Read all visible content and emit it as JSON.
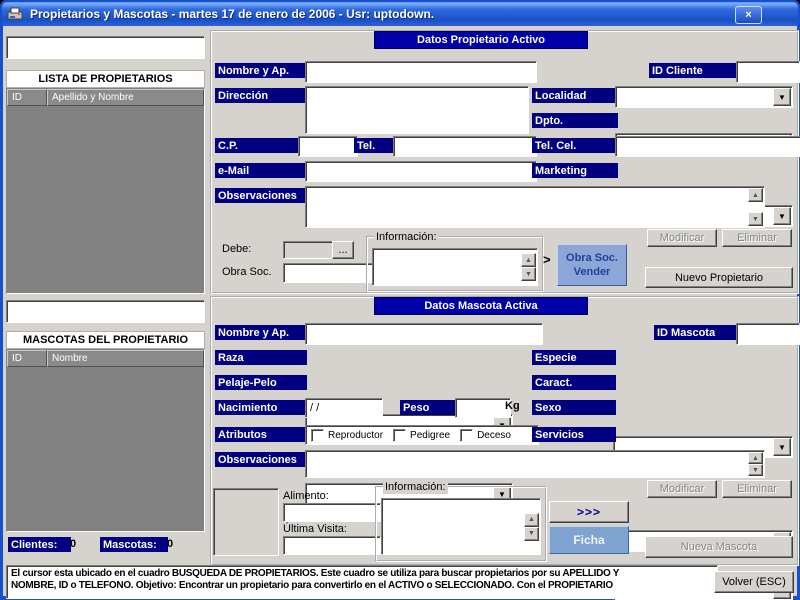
{
  "titlebar": {
    "title": "Propietarios y Mascotas - martes 17 de enero de 2006 - Usr: uptodown.",
    "close_glyph": "×"
  },
  "icons": {
    "dropdown_arrow": "▼",
    "scroll_up": "▲",
    "scroll_down": "▼",
    "chevron_right": ">",
    "chevrons_right": ">>>"
  },
  "sidebar": {
    "owner_search_value": "",
    "owners_title": "LISTA DE PROPIETARIOS",
    "owners_columns": {
      "id": "ID",
      "name": "Apellido y Nombre"
    },
    "pet_search_value": "",
    "pets_title": "MASCOTAS DEL PROPIETARIO",
    "pets_columns": {
      "id": "ID",
      "name": "Nombre"
    },
    "clients_label": "Clientes:",
    "clients_count": "0",
    "pets_label": "Mascotas:",
    "pets_count": "0"
  },
  "owner": {
    "section_title": "Datos Propietario Activo",
    "labels": {
      "nombre": "Nombre y Ap.",
      "id_cliente": "ID Cliente",
      "direccion": "Dirección",
      "localidad": "Localidad",
      "dpto": "Dpto.",
      "cp": "C.P.",
      "tel": "Tel.",
      "tel_cel": "Tel. Cel.",
      "email": "e-Mail",
      "marketing": "Marketing",
      "observaciones": "Observaciones",
      "debe": "Debe:",
      "obra_soc": "Obra Soc.",
      "informacion": "Información:"
    },
    "values": {
      "nombre": "",
      "id_cliente": "",
      "direccion": "",
      "cp": "",
      "tel": "",
      "tel_cel": "",
      "email": "",
      "observaciones": "",
      "debe": "",
      "obra_soc": "",
      "informacion": ""
    },
    "buttons": {
      "modificar": "Modificar",
      "eliminar": "Eliminar",
      "dots": "...",
      "obra_soc_line1": "Obra Soc.",
      "obra_soc_line2": "Vender",
      "nuevo_propietario": "Nuevo Propietario"
    }
  },
  "pet": {
    "section_title": "Datos Mascota Activa",
    "labels": {
      "nombre": "Nombre y Ap.",
      "id_mascota": "ID Mascota",
      "raza": "Raza",
      "especie": "Especie",
      "pelaje": "Pelaje-Pelo",
      "caract": "Caract.",
      "nacimiento": "Nacimiento",
      "peso": "Peso",
      "kg": "Kg",
      "sexo": "Sexo",
      "atributos": "Atributos",
      "servicios": "Servicios",
      "observaciones": "Observaciones",
      "alimento": "Alimento:",
      "ultima_visita": "Última Visita:",
      "informacion": "Información:"
    },
    "values": {
      "nombre": "",
      "id_mascota": "",
      "nacimiento": "/ /",
      "peso": "",
      "observaciones": "",
      "alimento": "",
      "ultima_visita": "",
      "informacion": ""
    },
    "checkboxes": [
      "Reproductor",
      "Pedigree",
      "Deceso"
    ],
    "buttons": {
      "modificar": "Modificar",
      "eliminar": "Eliminar",
      "ficha": "Ficha",
      "nueva_mascota": "Nueva Mascota"
    }
  },
  "statusbar": {
    "line1": "El cursor esta ubicado en el cuadro BUSQUEDA DE PROPIETARIOS. Este cuadro se utiliza para buscar propietarios por su APELLIDO Y",
    "line2": "NOMBRE, ID o TELEFONO. Objetivo: Encontrar un propietario para convertirlo en el ACTIVO o SELECCIONADO. Con el PROPIETARIO",
    "volver": "Volver (ESC)"
  },
  "colors": {
    "label_navy": "#000080",
    "section_blue": "#0000a8",
    "window_gray": "#d6d3ce",
    "list_gray": "#828282",
    "accent_button_blue": "#8da6d8"
  }
}
